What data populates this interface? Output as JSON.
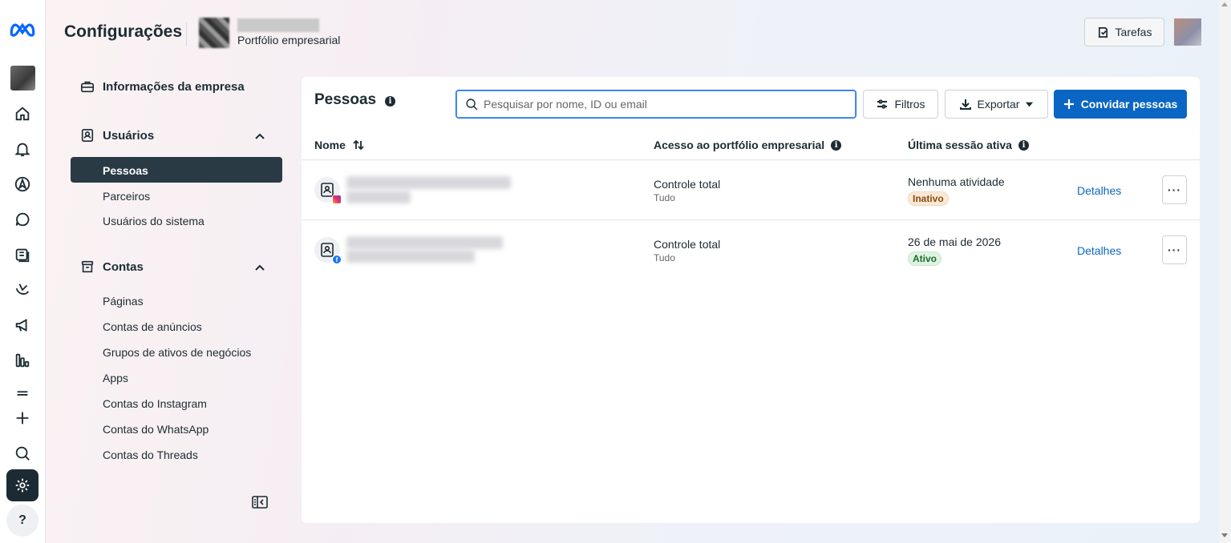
{
  "header": {
    "title": "Configurações",
    "portfolio_subtitle": "Portfólio empresarial",
    "tasks_label": "Tarefas"
  },
  "rail": {
    "items": [
      "meta-logo",
      "business-avatar",
      "home-icon",
      "bell-icon",
      "navigation-icon",
      "chat-icon",
      "stack-icon",
      "leaf-icon",
      "megaphone-icon",
      "chart-icon",
      "menu-icon",
      "plus-icon",
      "search-icon",
      "gear-icon"
    ],
    "help_label": "?"
  },
  "sidebar": {
    "company_info": "Informações da empresa",
    "users_section": "Usuários",
    "users_items": [
      "Pessoas",
      "Parceiros",
      "Usuários do sistema"
    ],
    "accounts_section": "Contas",
    "accounts_items": [
      "Páginas",
      "Contas de anúncios",
      "Grupos de ativos de negócios",
      "Apps",
      "Contas do Instagram",
      "Contas do WhatsApp",
      "Contas do Threads"
    ]
  },
  "panel": {
    "title": "Pessoas",
    "search_placeholder": "Pesquisar por nome, ID ou email",
    "filters_label": "Filtros",
    "export_label": "Exportar",
    "invite_label": "Convidar pessoas",
    "columns": [
      "Nome",
      "Acesso ao portfólio empresarial",
      "Última sessão ativa"
    ],
    "rows": [
      {
        "platform": "instagram",
        "access": "Controle total",
        "access_scope": "Tudo",
        "last_session": "Nenhuma atividade",
        "status": "Inativo",
        "details": "Detalhes",
        "more": "···"
      },
      {
        "platform": "facebook",
        "access": "Controle total",
        "access_scope": "Tudo",
        "last_session": "26 de mai de 2026",
        "status": "Ativo",
        "details": "Detalhes",
        "more": "···"
      }
    ]
  },
  "colors": {
    "accent": "#0a66c2",
    "active_nav": "#293a44",
    "status_inactive": "#8a4b0f",
    "status_active": "#1d6b2f"
  }
}
